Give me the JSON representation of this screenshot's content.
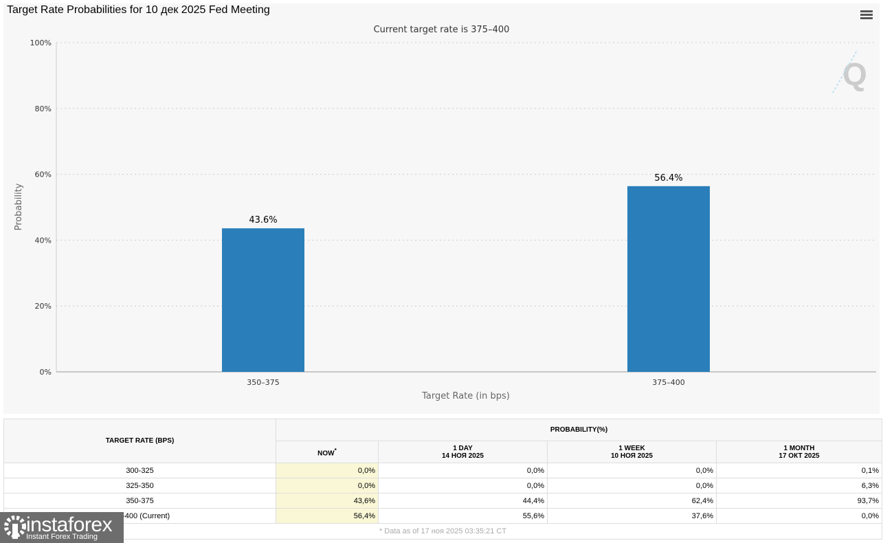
{
  "chart_data": {
    "type": "bar",
    "title": "Target Rate Probabilities for 10 дек 2025 Fed Meeting",
    "subtitle": "Current target rate is 375–400",
    "xlabel": "Target Rate (in bps)",
    "ylabel": "Probability",
    "categories": [
      "350–375",
      "375–400"
    ],
    "values": [
      43.6,
      56.4
    ],
    "data_labels": [
      "43.6%",
      "56.4%"
    ],
    "ylim": [
      0,
      100
    ],
    "yticks": [
      "0%",
      "20%",
      "40%",
      "60%",
      "80%",
      "100%"
    ],
    "grid": true,
    "bar_color": "#2a7fba",
    "legend": "none"
  },
  "table": {
    "target_header": "TARGET RATE (BPS)",
    "prob_header": "PROBABILITY(%)",
    "columns": [
      {
        "label": "NOW",
        "sup": "*",
        "date": ""
      },
      {
        "label": "1 DAY",
        "date": "14 НОЯ 2025"
      },
      {
        "label": "1 WEEK",
        "date": "10 НОЯ 2025"
      },
      {
        "label": "1 MONTH",
        "date": "17 ОКТ 2025"
      }
    ],
    "rows": [
      {
        "rate": "300-325",
        "values": [
          "0,0%",
          "0,0%",
          "0,0%",
          "0,1%"
        ]
      },
      {
        "rate": "325-350",
        "values": [
          "0,0%",
          "0,0%",
          "0,0%",
          "6,3%"
        ]
      },
      {
        "rate": "350-375",
        "values": [
          "43,6%",
          "44,4%",
          "62,4%",
          "93,7%"
        ]
      },
      {
        "rate": "375-400 (Current)",
        "values": [
          "56,4%",
          "55,6%",
          "37,6%",
          "0,0%"
        ]
      }
    ],
    "footnote": "* Data as of 17 ноя 2025 03:35:21 CT"
  },
  "watermark": {
    "name": "instaforex",
    "tagline": "Instant Forex Trading"
  },
  "icons": {
    "menu": "hamburger-menu-icon",
    "logo": "quikstrike-q-logo"
  }
}
